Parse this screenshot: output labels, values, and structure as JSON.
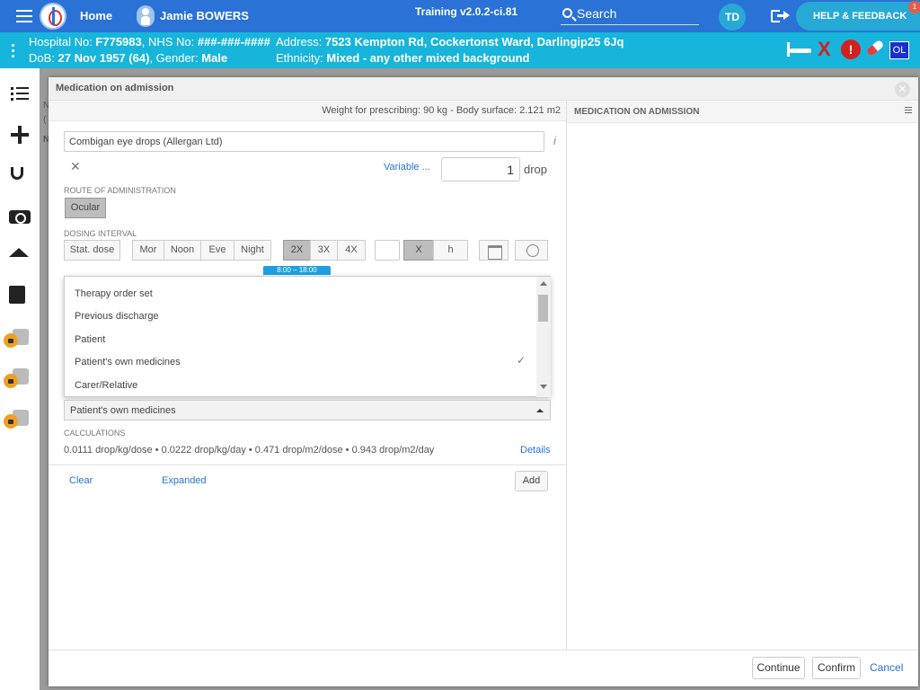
{
  "topbar": {
    "home": "Home",
    "patient_name": "Jamie BOWERS",
    "training": "Training v2.0.2-ci.81",
    "search_placeholder": "Search",
    "avatar": "TD",
    "help": "HELP & FEEDBACK",
    "notification_count": "1"
  },
  "patient": {
    "hospital_label": "Hospital No: ",
    "hospital_no": "F775983",
    "nhs_label": ", NHS No: ",
    "nhs_no": "###-###-####",
    "dob_label": "DoB: ",
    "dob": "27 Nov 1957 (64)",
    "gender_label": ", Gender: ",
    "gender": "Male",
    "address_label": "Address: ",
    "address": "7523 Kempton Rd, Cockertonst Ward, Darlingip25 6Jq",
    "ethnicity_label": "Ethnicity: ",
    "ethnicity": "Mixed - any other mixed background",
    "icons": [
      "bed-icon",
      "x-icon",
      "alert-icon",
      "pill-icon"
    ],
    "ol": "OL",
    "alert_mark": "!",
    "x_mark": "X"
  },
  "modal": {
    "title": "Medication on admission",
    "close": "✕",
    "weight": "Weight for prescribing: 90 kg - Body surface: 2.121 m2",
    "right_title": "MEDICATION ON ADMISSION",
    "drug": "Combigan eye drops (Allergan Ltd)",
    "info": "i",
    "clear_x": "✕",
    "variable": "Variable ...",
    "dose_value": "1",
    "dose_unit": "drop",
    "route_label": "ROUTE OF ADMINISTRATION",
    "route": "Ocular",
    "interval_label": "DOSING INTERVAL",
    "interval_buttons": [
      "Stat. dose",
      "Mor",
      "Noon",
      "Eve",
      "Night",
      "2X",
      "3X",
      "4X",
      "X",
      "h"
    ],
    "tooltip": "8:00 – 18:00",
    "source_options": [
      "Therapy order set",
      "Previous discharge",
      "Patient",
      "Patient's own medicines",
      "Carer/Relative"
    ],
    "selected_check": "✓",
    "source_selected": "Patient's own medicines",
    "calc_label": "CALCULATIONS",
    "calc": "0.0111 drop/kg/dose • 0.0222 drop/kg/day • 0.471 drop/m2/dose • 0.943 drop/m2/day",
    "details": "Details",
    "clear": "Clear",
    "expanded": "Expanded",
    "add": "Add",
    "continue": "Continue",
    "confirm": "Confirm",
    "cancel": "Cancel"
  },
  "background": {
    "fragment1": "N",
    "fragment2": "(",
    "fragment3": "N"
  },
  "colors": {
    "topbar": "#2a72d6",
    "patient_bar": "#17b5dc",
    "accent": "#27a9d6",
    "link": "#2a72d6"
  }
}
